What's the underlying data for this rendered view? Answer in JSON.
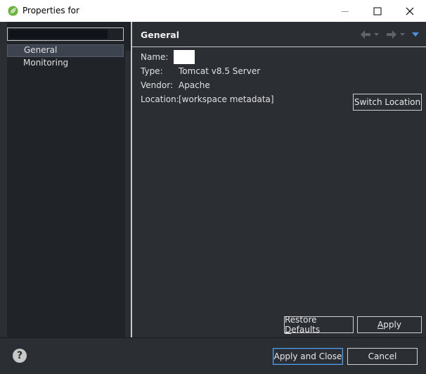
{
  "window": {
    "title": "Properties for",
    "minimize_icon": "minimize-icon",
    "maximize_icon": "maximize-icon",
    "close_icon": "close-icon"
  },
  "sidebar": {
    "filter": {
      "value": "",
      "placeholder": ""
    },
    "items": [
      {
        "label": "General",
        "selected": true
      },
      {
        "label": "Monitoring",
        "selected": false
      }
    ]
  },
  "page": {
    "title": "General",
    "nav": {
      "back_icon": "arrow-left-icon",
      "forward_icon": "arrow-right-icon",
      "menu_icon": "view-menu-icon"
    },
    "fields": [
      {
        "label": "Name:",
        "value": ""
      },
      {
        "label": "Type:",
        "value": "Tomcat v8.5 Server"
      },
      {
        "label": "Vendor:",
        "value": "Apache"
      },
      {
        "label": "Location:",
        "value": "[workspace metadata]"
      }
    ],
    "switch_location_label": "Switch Location",
    "restore_defaults_label_pre": "Restore ",
    "restore_defaults_label_mnemonic": "D",
    "restore_defaults_label_post": "efaults",
    "apply_label_mnemonic": "A",
    "apply_label_post": "pply"
  },
  "footer": {
    "help_icon": "help-icon",
    "help_glyph": "?",
    "apply_close_label": "Apply and Close",
    "cancel_label": "Cancel"
  },
  "colors": {
    "background": "#2b2f34",
    "sidebar": "#202428",
    "selection": "#3d4450",
    "default_button_border": "#5aa0e6",
    "title_bar": "#ffffff",
    "app_icon_green": "#6db33f"
  }
}
